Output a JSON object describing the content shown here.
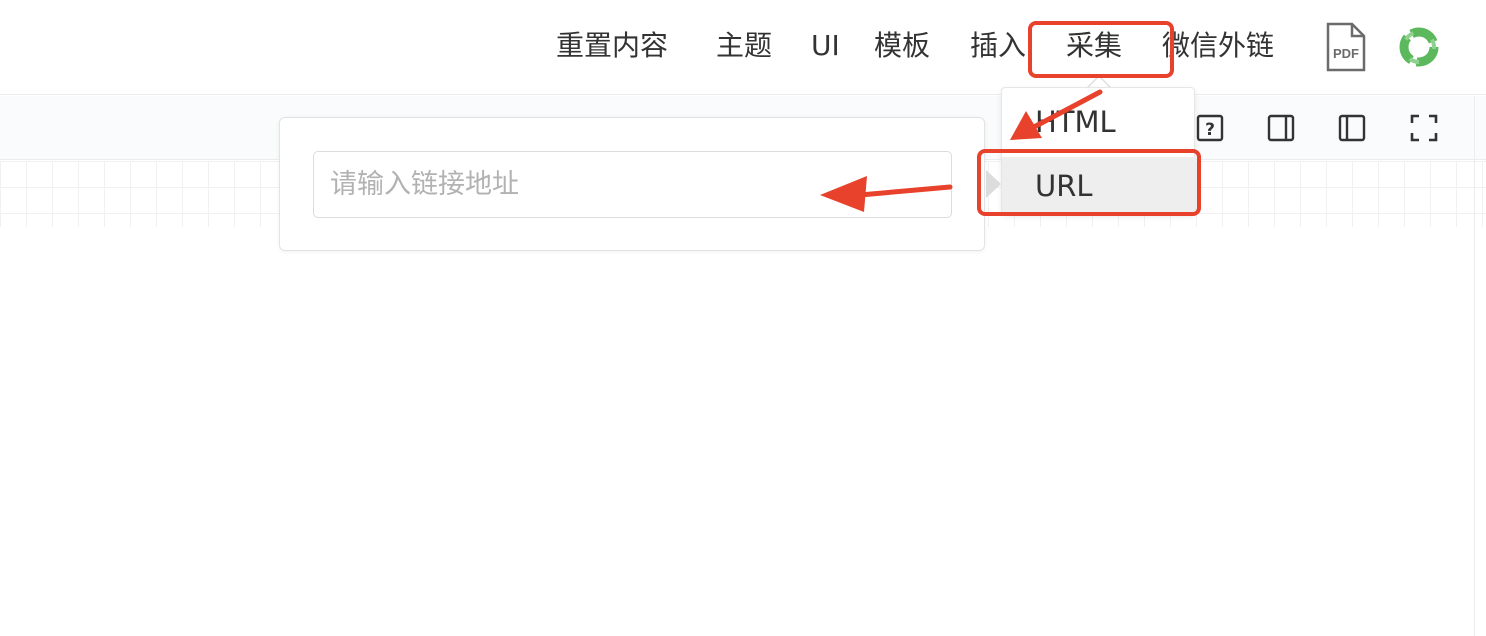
{
  "header": {
    "menu": [
      {
        "id": "reset",
        "label": "重置内容"
      },
      {
        "id": "theme",
        "label": "主题"
      },
      {
        "id": "ui",
        "label": "UI"
      },
      {
        "id": "template",
        "label": "模板"
      },
      {
        "id": "insert",
        "label": "插入"
      },
      {
        "id": "collect",
        "label": "采集"
      },
      {
        "id": "wechat",
        "label": "微信外链"
      }
    ],
    "pdf_icon": "pdf-file-icon",
    "pdf_label": "PDF",
    "logo_icon": "green-ring-logo-icon"
  },
  "toolbar": {
    "icons": [
      "help-icon",
      "right-panel-icon",
      "left-panel-icon",
      "fullscreen-icon"
    ],
    "help_glyph": "?"
  },
  "collect_dropdown": {
    "items": [
      {
        "label": "HTML",
        "active": false
      },
      {
        "label": "URL",
        "active": true
      }
    ]
  },
  "url_popover": {
    "placeholder": "请输入链接地址",
    "value": ""
  },
  "colors": {
    "annotation_red": "#e8412c",
    "logo_green": "#5cb85c",
    "active_item_bg": "#eeeeef"
  }
}
